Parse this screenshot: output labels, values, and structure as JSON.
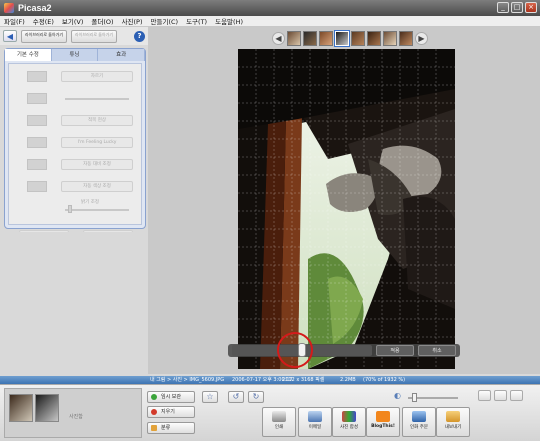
{
  "window": {
    "title": "Picasa2",
    "min": "_",
    "max": "□",
    "close": "×"
  },
  "menu": [
    "파일(F)",
    "수정(E)",
    "보기(V)",
    "폴더(O)",
    "사진(P)",
    "만들기(C)",
    "도구(T)",
    "도움말(H)"
  ],
  "toolbar": {
    "back_icon": "left-arrow-icon",
    "library_btn": "라이브러리로 돌아가기",
    "library_btn2": "라이브러리로 돌아가기",
    "help": "?"
  },
  "edit_tabs": [
    "기본 수정",
    "튜닝",
    "효과"
  ],
  "edit_tools": [
    {
      "label": "자르기"
    },
    {
      "label": ""
    },
    {
      "label": "적목 현상"
    },
    {
      "label": "I'm Feeling Lucky"
    },
    {
      "label": "자동 대비 조정"
    },
    {
      "label": "자동 색상 조정"
    }
  ],
  "fill_light_label": "밝기 조정",
  "fill_light_level": 0.05,
  "undo_label": "취소",
  "redo_label": "재실행",
  "straighten": {
    "level": 0.5,
    "apply": "적용",
    "cancel": "취소"
  },
  "status": {
    "path": "내 그림 > 사진 > IMG_5609.JPG",
    "date": "2006-07-17 오후 3:00:17",
    "dims": "2112 x 3168 픽셀",
    "size": "2.2MB",
    "zoom": "(70% of 1932 %)"
  },
  "tray": {
    "album_label": "사진함",
    "buttons": [
      "임시 보관",
      "지우기",
      "분류"
    ]
  },
  "actions": [
    "인쇄",
    "이메일",
    "사진 합성",
    "BlogThis!",
    "인화 주문",
    "내보내기"
  ],
  "colors": {
    "accent": "#3d74b3",
    "status": "#4a80bd",
    "highlight": "#d51a1a"
  }
}
